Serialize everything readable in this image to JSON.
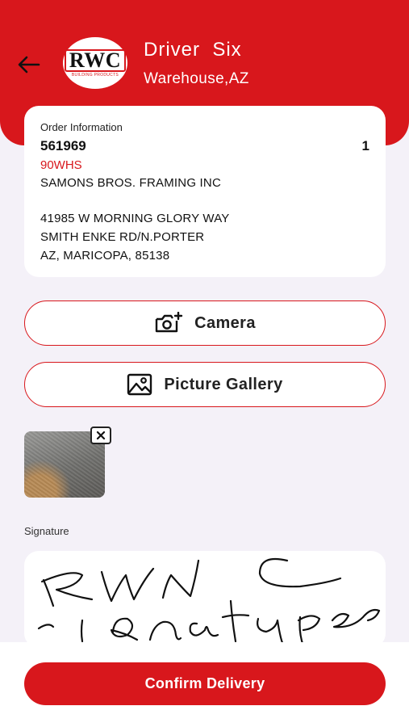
{
  "header": {
    "driver_name": "Driver  Six",
    "location": "Warehouse,AZ",
    "logo_text": "RWC",
    "logo_subtext": "BUILDING PRODUCTS",
    "back_icon": "arrow-left-icon",
    "color": "#d8171c"
  },
  "order": {
    "label": "Order Information",
    "number": "561969",
    "count": "1",
    "code": "90WHS",
    "customer": "SAMONS BROS. FRAMING INC",
    "address_line1": "41985 W MORNING GLORY WAY",
    "address_line2": "SMITH ENKE RD/N.PORTER",
    "address_line3": "AZ, MARICOPA, 85138"
  },
  "actions": {
    "camera_label": "Camera",
    "camera_icon": "camera-add-icon",
    "gallery_label": "Picture Gallery",
    "gallery_icon": "image-icon"
  },
  "photos": [
    {
      "remove_icon": "close-icon"
    }
  ],
  "signature": {
    "label": "Signature"
  },
  "footer": {
    "confirm_label": "Confirm Delivery"
  }
}
